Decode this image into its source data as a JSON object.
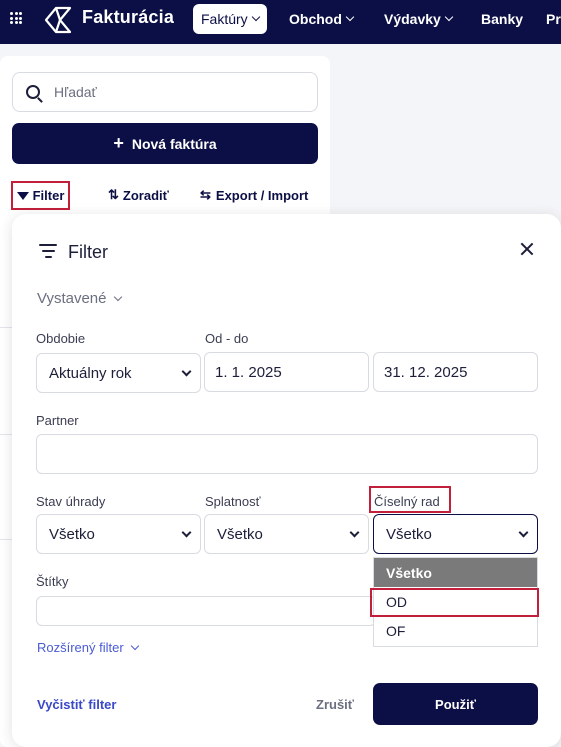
{
  "topbar": {
    "brand": "Fakturácia",
    "nav": [
      {
        "label": "Faktúry",
        "active": true
      },
      {
        "label": "Obchod"
      },
      {
        "label": "Výdavky"
      },
      {
        "label": "Banky"
      },
      {
        "label": "Pr"
      }
    ]
  },
  "sidebar": {
    "search_placeholder": "Hľadať",
    "new_invoice_label": "Nová faktúra",
    "filter_label": "Filter",
    "sort_label": "Zoradiť",
    "export_label": "Export / Import"
  },
  "modal": {
    "title": "Filter",
    "issued_label": "Vystavené",
    "period_label": "Obdobie",
    "period_value": "Aktuálny rok",
    "date_range_label": "Od - do",
    "date_from": "1. 1. 2025",
    "date_to": "31. 12. 2025",
    "partner_label": "Partner",
    "partner_value": "",
    "payment_status_label": "Stav úhrady",
    "payment_status_value": "Všetko",
    "due_label": "Splatnosť",
    "due_value": "Všetko",
    "number_series_label": "Číselný rad",
    "number_series_value": "Všetko",
    "number_series_options": [
      "Všetko",
      "OD",
      "OF"
    ],
    "tags_label": "Štítky",
    "tags_value": "",
    "advanced_filter_label": "Rozšírený filter",
    "clear_filter_label": "Vyčistiť filter",
    "cancel_label": "Zrušiť",
    "apply_label": "Použiť"
  },
  "colors": {
    "navy": "#0c0f45",
    "highlight_red": "#c21f3a",
    "link_blue": "#3949c8",
    "selected_option_gray": "#7a7a7a"
  }
}
